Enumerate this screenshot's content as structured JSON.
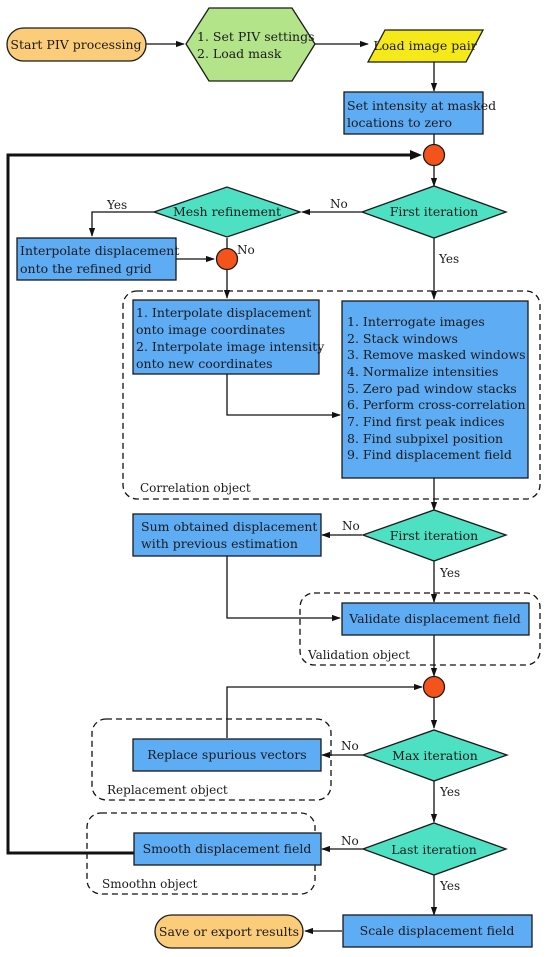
{
  "colors": {
    "terminal": "#fbcd7b",
    "setup": "#b3e48a",
    "io": "#f6e91a",
    "process": "#5eacf4",
    "decision": "#4ee0c2",
    "junction": "#f4541c"
  },
  "nodes": {
    "start": "Start PIV processing",
    "settings": [
      "1. Set PIV settings",
      "2. Load mask"
    ],
    "load": "Load image pair",
    "mask_zero": [
      "Set intensity at masked",
      "locations to zero"
    ],
    "first_iter_1": "First iteration",
    "mesh_ref": "Mesh refinement",
    "interp_grid": [
      "Interpolate displacement",
      "onto the refined grid"
    ],
    "interp_img": [
      "1. Interpolate displacement",
      "onto image coordinates",
      "2. Interpolate image intensity",
      "onto new coordinates"
    ],
    "correlation_steps": [
      "1. Interrogate images",
      "2. Stack windows",
      "3. Remove masked windows",
      "4. Normalize intensities",
      "5. Zero pad window stacks",
      "6. Perform cross-correlation",
      "7. Find first peak indices",
      "8. Find subpixel position",
      "9. Find displacement field"
    ],
    "first_iter_2": "First iteration",
    "sum_disp": [
      "Sum obtained displacement",
      "with previous estimation"
    ],
    "validate": "Validate displacement field",
    "max_iter": "Max iteration",
    "replace": "Replace spurious vectors",
    "last_iter": "Last iteration",
    "smooth": "Smooth displacement field",
    "scale": "Scale displacement field",
    "save": "Save or export results"
  },
  "groups": {
    "correlation": "Correlation object",
    "validation": "Validation object",
    "replacement": "Replacement object",
    "smoothn": "Smoothn object"
  },
  "edge_labels": {
    "yes": "Yes",
    "no": "No"
  }
}
